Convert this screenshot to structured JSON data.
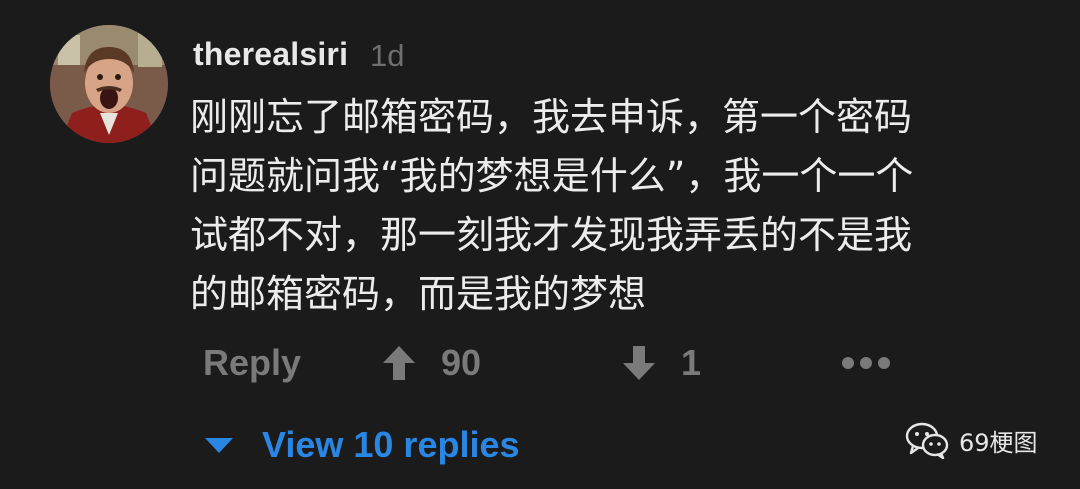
{
  "comment": {
    "username": "therealsiri",
    "time_ago": "1d",
    "avatar_icon": "user-avatar-shouting-man",
    "body_lines": [
      "刚刚忘了邮箱密码，我去申诉，第一个密码",
      "问题就问我“我的梦想是什么”，我一个一个",
      "试都不对，那一刻我才发现我弄丢的不是我",
      "的邮箱密码，而是我的梦想"
    ]
  },
  "actions": {
    "reply_label": "Reply",
    "upvote_icon": "arrow-up-icon",
    "upvote_count": "90",
    "downvote_icon": "arrow-down-icon",
    "downvote_count": "1",
    "more_icon": "more-horizontal-icon"
  },
  "replies": {
    "caret_icon": "caret-down-icon",
    "label": "View 10 replies"
  },
  "watermark": {
    "icon": "wechat-icon",
    "label": "69梗图"
  },
  "colors": {
    "background": "#1b1b1b",
    "text": "#ececec",
    "muted": "#7a7a7a",
    "link": "#2a86e3"
  }
}
